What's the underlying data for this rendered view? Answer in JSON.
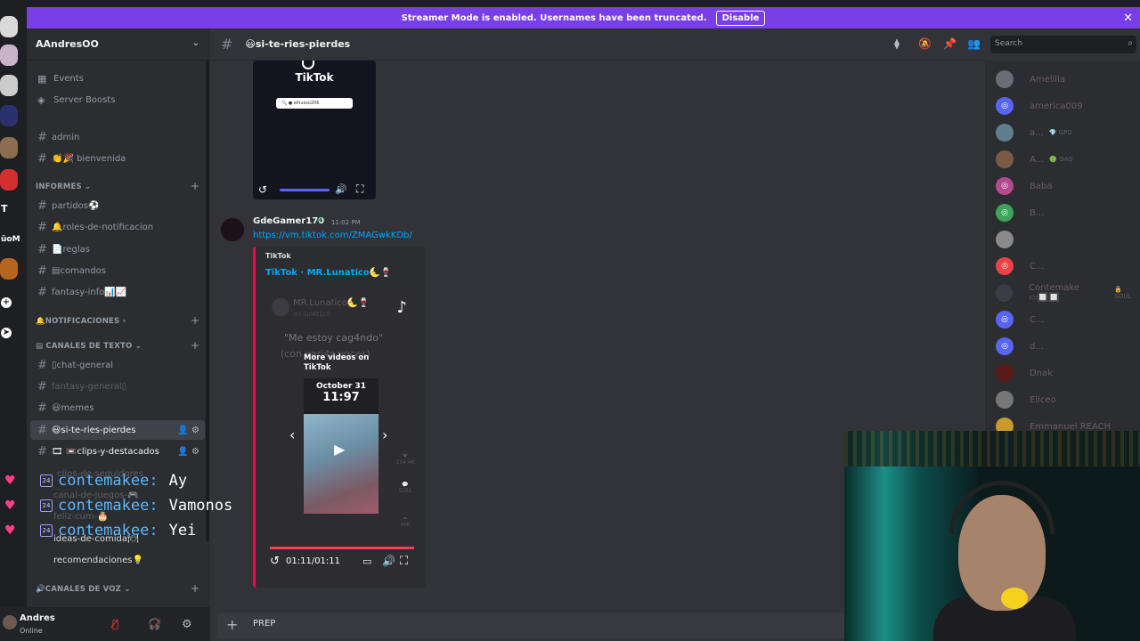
{
  "banner": {
    "text": "Streamer Mode is enabled. Usernames have been truncated.",
    "button": "Disable",
    "close": "✕"
  },
  "rail": {
    "t_label": "T",
    "om_label": "üoM"
  },
  "guild": {
    "name": "AAndresOO",
    "chevron": "⌄"
  },
  "sidebar": {
    "events": "Events",
    "boosts": "Server Boosts",
    "admin": "admin",
    "bienvenida": "👏🎉 bienvenida",
    "cat_informes": "INFORMES ⌄",
    "partidos": "partidos⚽",
    "roles": "🔔roles-de-notificacion",
    "reglas": "📄reglas",
    "comandos": "▤comandos",
    "fantasy_info": "fantasy-info📊📈",
    "cat_notificaciones": "🔔NOTIFICACIONES ›",
    "cat_texto": "▤ CANALES DE TEXTO ⌄",
    "chat_general": "▯chat-general",
    "fantasy_general": "fantasy-general▯",
    "memes": "😃memes",
    "si_te_ries": "😃si-te-ries-pierdes",
    "clips": "🎞 📼clips-y-destacados",
    "clips_seg": "clips-de-seguidores",
    "canal_juegos": "canal-de-juegos-🎮",
    "feliz_cum": "feliz-cum-🎂",
    "ideas": "ideas-de-comida🍽",
    "recomendaciones": "recomendaciones💡",
    "cat_voz": "🔊CANALES DE VOZ ⌄",
    "plus": "+"
  },
  "overlay": [
    {
      "name": "contemakee:",
      "text": "Ay"
    },
    {
      "name": "contemakee:",
      "text": "Vamonos"
    },
    {
      "name": "contemakee:",
      "text": "Yei"
    }
  ],
  "overlay_badge": "24",
  "user": {
    "name": "Andres",
    "status": "Online"
  },
  "header": {
    "channel": "😃si-te-ries-pierdes",
    "search_placeholder": "Search"
  },
  "tiktok_top": {
    "word": "TikTok",
    "search": "🔍 ● elhusso206"
  },
  "message": {
    "author": "GdeGamer170",
    "check": "✔",
    "time": "11:02 PM",
    "link": "https://vm.tiktok.com/ZMAGwkKDb/",
    "provider": "TikTok",
    "title": "TikTok · MR.Lunatico🌜🍷",
    "blur_name": "MR.Lunatico🌜🍷",
    "blur_handle": "mr.lun4t1c0",
    "quote1": "\"Me estoy cag4ndo\"",
    "quote2": "(con vari4s voces)",
    "more_videos": "More videos on TikTok",
    "card_date": "October 31",
    "card_time": "11:97",
    "stat1": "154.4K",
    "stat2": "5261",
    "stat3": "40K",
    "duration": "01:11/01:11"
  },
  "composer": {
    "text": "PREP"
  },
  "members": [
    {
      "name": "Amelilla",
      "extra": ""
    },
    {
      "name": "america009",
      "extra": ""
    },
    {
      "name": "a...",
      "extra": "💎 GPO"
    },
    {
      "name": "A...",
      "extra": "🟢 GAG"
    },
    {
      "name": "Baba",
      "extra": ""
    },
    {
      "name": "B...",
      "extra": ""
    },
    {
      "name": "",
      "extra": ""
    },
    {
      "name": "C...",
      "extra": ""
    },
    {
      "name": "Contemake ▭🔲🔲",
      "extra": "🔒 SOUL"
    },
    {
      "name": "C...",
      "extra": ""
    },
    {
      "name": "d...",
      "extra": ""
    },
    {
      "name": "Dnak",
      "extra": ""
    },
    {
      "name": "Eliceo",
      "extra": ""
    },
    {
      "name": "Emmanuel REACH",
      "extra": ""
    }
  ],
  "colors": {
    "accent": "#5865f2",
    "banner": "#7a3ee6",
    "tiktok_red": "#ff0050",
    "link": "#00a8fc",
    "overlay_name": "#57b9ff"
  }
}
